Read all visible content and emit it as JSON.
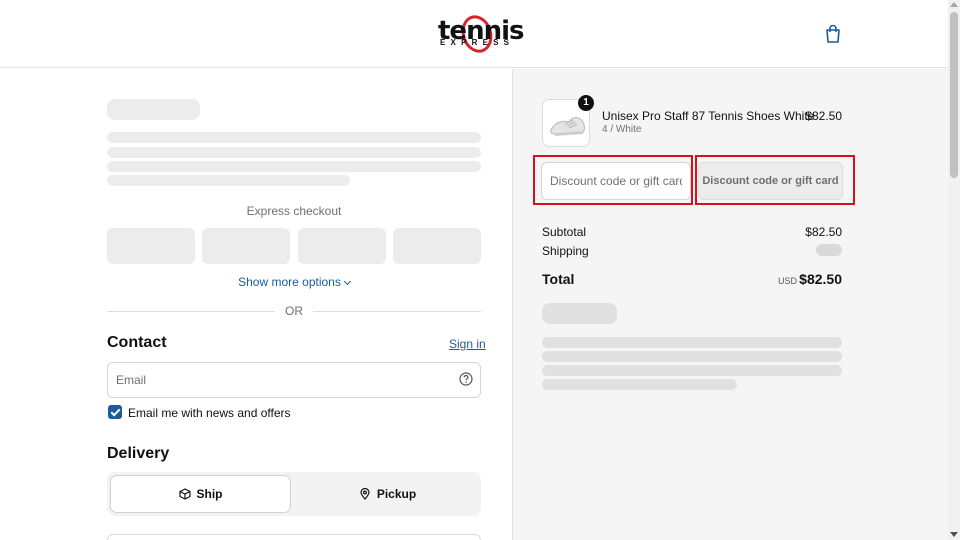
{
  "header": {
    "logo_main": "tennis",
    "logo_sub": "EXPRESS"
  },
  "express": {
    "title": "Express checkout",
    "show_more": "Show more options",
    "or": "OR"
  },
  "contact": {
    "title": "Contact",
    "sign_in": "Sign in",
    "email_placeholder": "Email",
    "newsletter_label": "Email me with news and offers",
    "newsletter_checked": true
  },
  "delivery": {
    "title": "Delivery",
    "options": [
      {
        "label": "Ship",
        "selected": true
      },
      {
        "label": "Pickup",
        "selected": false
      }
    ]
  },
  "order": {
    "items": [
      {
        "name": "Unisex Pro Staff 87 Tennis Shoes White",
        "variant": "4 / White",
        "price": "$82.50",
        "quantity": "1"
      }
    ],
    "discount_placeholder": "Discount code or gift card",
    "discount_button": "Discount code or gift card",
    "subtotal_label": "Subtotal",
    "subtotal_value": "$82.50",
    "shipping_label": "Shipping",
    "total_label": "Total",
    "total_currency": "USD",
    "total_value": "$82.50"
  },
  "colors": {
    "accent": "#1d5b9b",
    "highlight": "#d8101b",
    "brand_red": "#d8232a"
  }
}
